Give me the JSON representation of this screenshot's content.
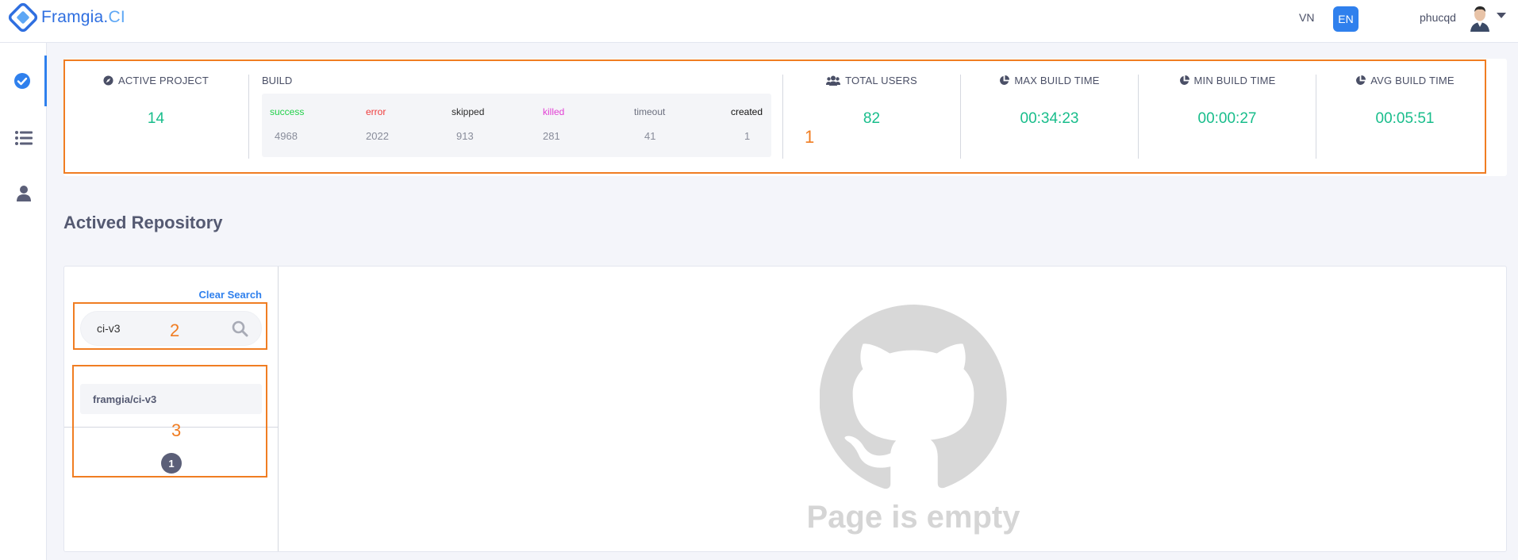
{
  "header": {
    "logo_name": "Framgia.",
    "logo_ci": "CI",
    "lang_vn": "VN",
    "lang_en": "EN",
    "username": "phucqd"
  },
  "sidebar": {
    "items": [
      {
        "icon": "check-circle-icon",
        "active": true
      },
      {
        "icon": "list-icon",
        "active": false
      },
      {
        "icon": "user-icon",
        "active": false
      }
    ]
  },
  "stats": {
    "active_project": {
      "label": "ACTIVE PROJECT",
      "value": "14",
      "icon": "compass-icon"
    },
    "build": {
      "label": "BUILD",
      "columns": [
        {
          "status": "success",
          "count": "4968",
          "color": "#22d04a"
        },
        {
          "status": "error",
          "count": "2022",
          "color": "#ef3b3b"
        },
        {
          "status": "skipped",
          "count": "913",
          "color": "#2b2b2b"
        },
        {
          "status": "killed",
          "count": "281",
          "color": "#e23fd4"
        },
        {
          "status": "timeout",
          "count": "41",
          "color": "#6b6f7e"
        },
        {
          "status": "created",
          "count": "1",
          "color": "#111111"
        }
      ]
    },
    "total_users": {
      "label": "TOTAL USERS",
      "value": "82",
      "icon": "users-icon"
    },
    "max_build_time": {
      "label": "MAX BUILD TIME",
      "value": "00:34:23",
      "icon": "pie-chart-icon"
    },
    "min_build_time": {
      "label": "MIN BUILD TIME",
      "value": "00:00:27",
      "icon": "pie-chart-icon"
    },
    "avg_build_time": {
      "label": "AVG BUILD TIME",
      "value": "00:05:51",
      "icon": "pie-chart-icon"
    }
  },
  "annotations": {
    "one": "1",
    "two": "2",
    "three": "3",
    "color": "#f07d22"
  },
  "section": {
    "title": "Actived Repository"
  },
  "repo_panel": {
    "clear_search": "Clear Search",
    "search_value": "ci-v3",
    "results": [
      "framgia/ci-v3"
    ],
    "current_page": "1",
    "empty_text": "Page is empty"
  },
  "colors": {
    "accent": "#2f80ed",
    "value_green": "#18bd8b",
    "annotation": "#f07d22"
  }
}
